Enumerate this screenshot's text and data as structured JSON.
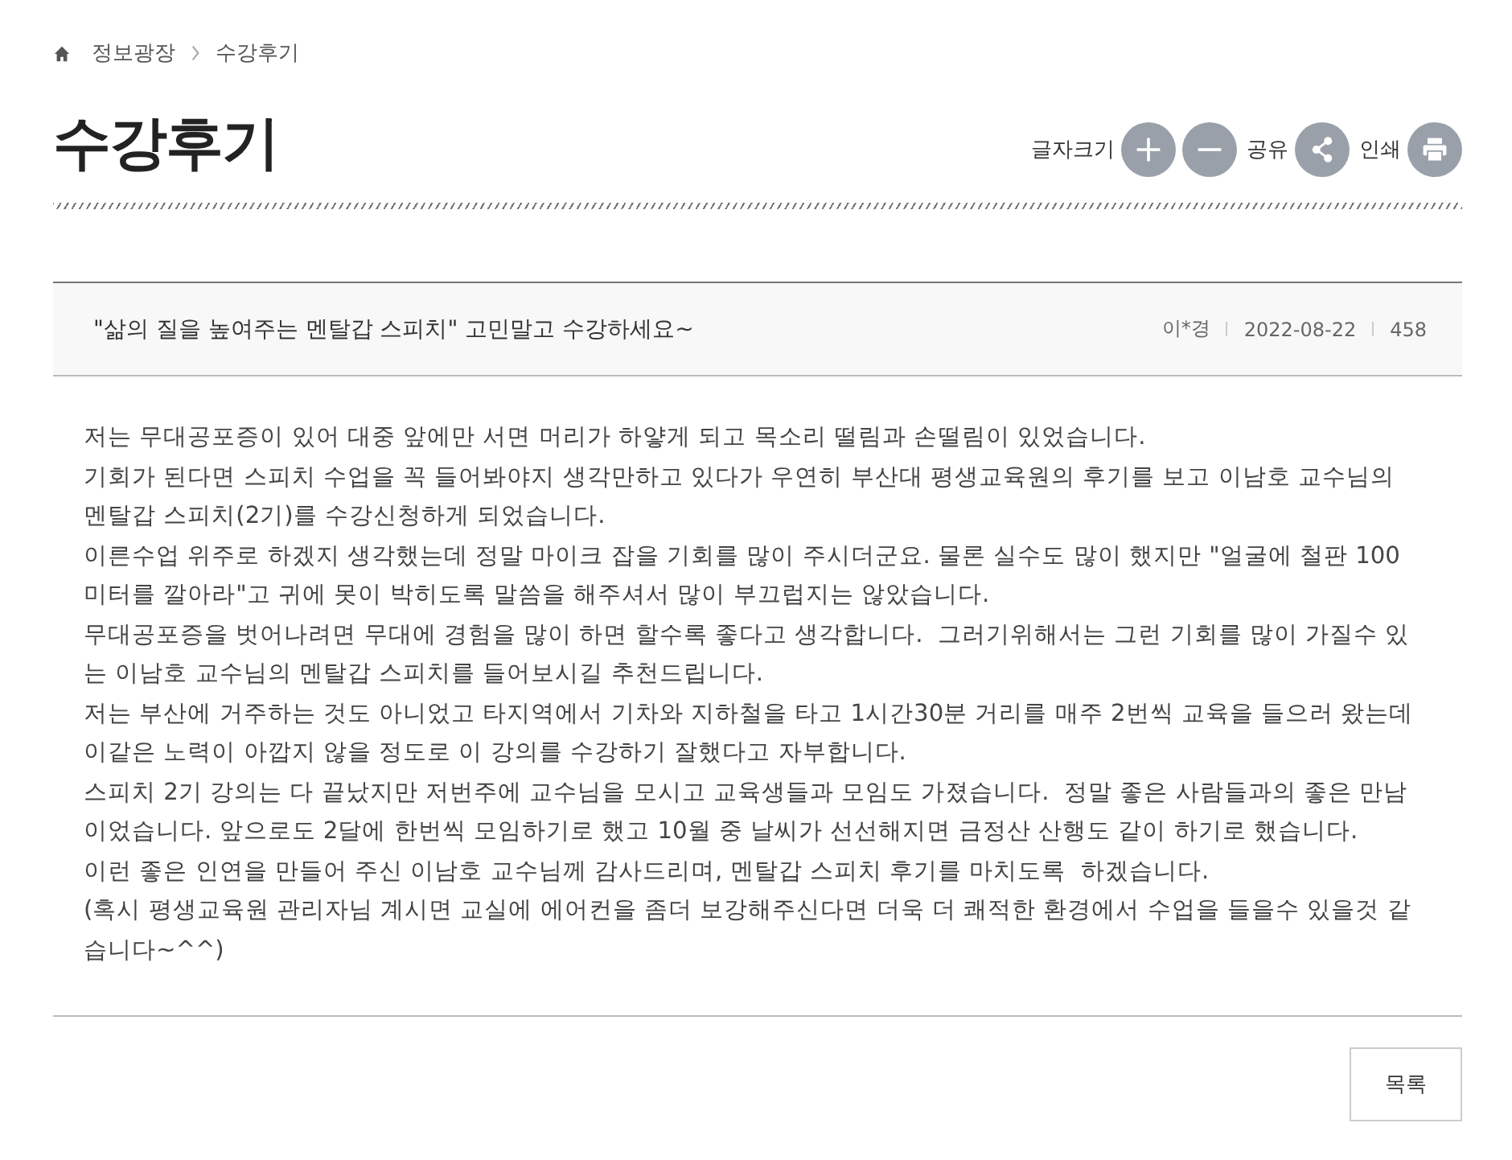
{
  "breadcrumb": [
    "정보광장",
    "수강후기"
  ],
  "page_title": "수강후기",
  "tools": [
    {
      "kind": "label",
      "text": "글자크기"
    },
    {
      "kind": "plus"
    },
    {
      "kind": "minus"
    },
    {
      "kind": "label",
      "text": "공유"
    },
    {
      "kind": "share"
    },
    {
      "kind": "label",
      "text": "인쇄"
    },
    {
      "kind": "print"
    }
  ],
  "post": {
    "title": "\"삶의 질을 높여주는 멘탈갑 스피치\" 고민말고 수강하세요~",
    "author": "이*경",
    "date": "2022-08-22",
    "views": "458",
    "paragraphs": [
      "저는 무대공포증이 있어 대중 앞에만 서면 머리가 하얗게 되고 목소리 떨림과 손떨림이 있었습니다.",
      "기회가 된다면 스피치 수업을 꼭 들어봐야지 생각만하고 있다가 우연히 부산대 평생교육원의 후기를 보고 이남호 교수님의 멘탈갑 스피치(2기)를 수강신청하게 되었습니다.",
      "이른수업 위주로 하겠지 생각했는데 정말 마이크 잡을 기회를 많이 주시더군요. 물론 실수도 많이 했지만 \"얼굴에 철판 100미터를 깔아라\"고 귀에 못이 박히도록 말씀을 해주셔서 많이 부끄럽지는 않았습니다.",
      "무대공포증을 벗어나려면 무대에 경험을 많이 하면 할수록 좋다고 생각합니다.  그러기위해서는 그런 기회를 많이 가질수 있는 이남호 교수님의 멘탈갑 스피치를 들어보시길 추천드립니다.",
      "저는 부산에 거주하는 것도 아니었고 타지역에서 기차와 지하철을 타고 1시간30분 거리를 매주 2번씩 교육을 들으러 왔는데 이같은 노력이 아깝지 않을 정도로 이 강의를 수강하기 잘했다고 자부합니다.",
      "스피치 2기 강의는 다 끝났지만 저번주에 교수님을 모시고 교육생들과 모임도 가졌습니다.  정말 좋은 사람들과의 좋은 만남이었습니다. 앞으로도 2달에 한번씩 모임하기로 했고 10월 중 날씨가 선선해지면 금정산 산행도 같이 하기로 했습니다.",
      "이런 좋은 인연을 만들어 주신 이남호 교수님께 감사드리며, 멘탈갑 스피치 후기를 마치도록  하겠습니다.",
      "(혹시 평생교육원 관리자님 계시면 교실에 에어컨을 좀더 보강해주신다면 더욱 더 쾌적한 환경에서 수업을 들을수 있을것 같습니다~^^)"
    ]
  },
  "list_button": "목록"
}
